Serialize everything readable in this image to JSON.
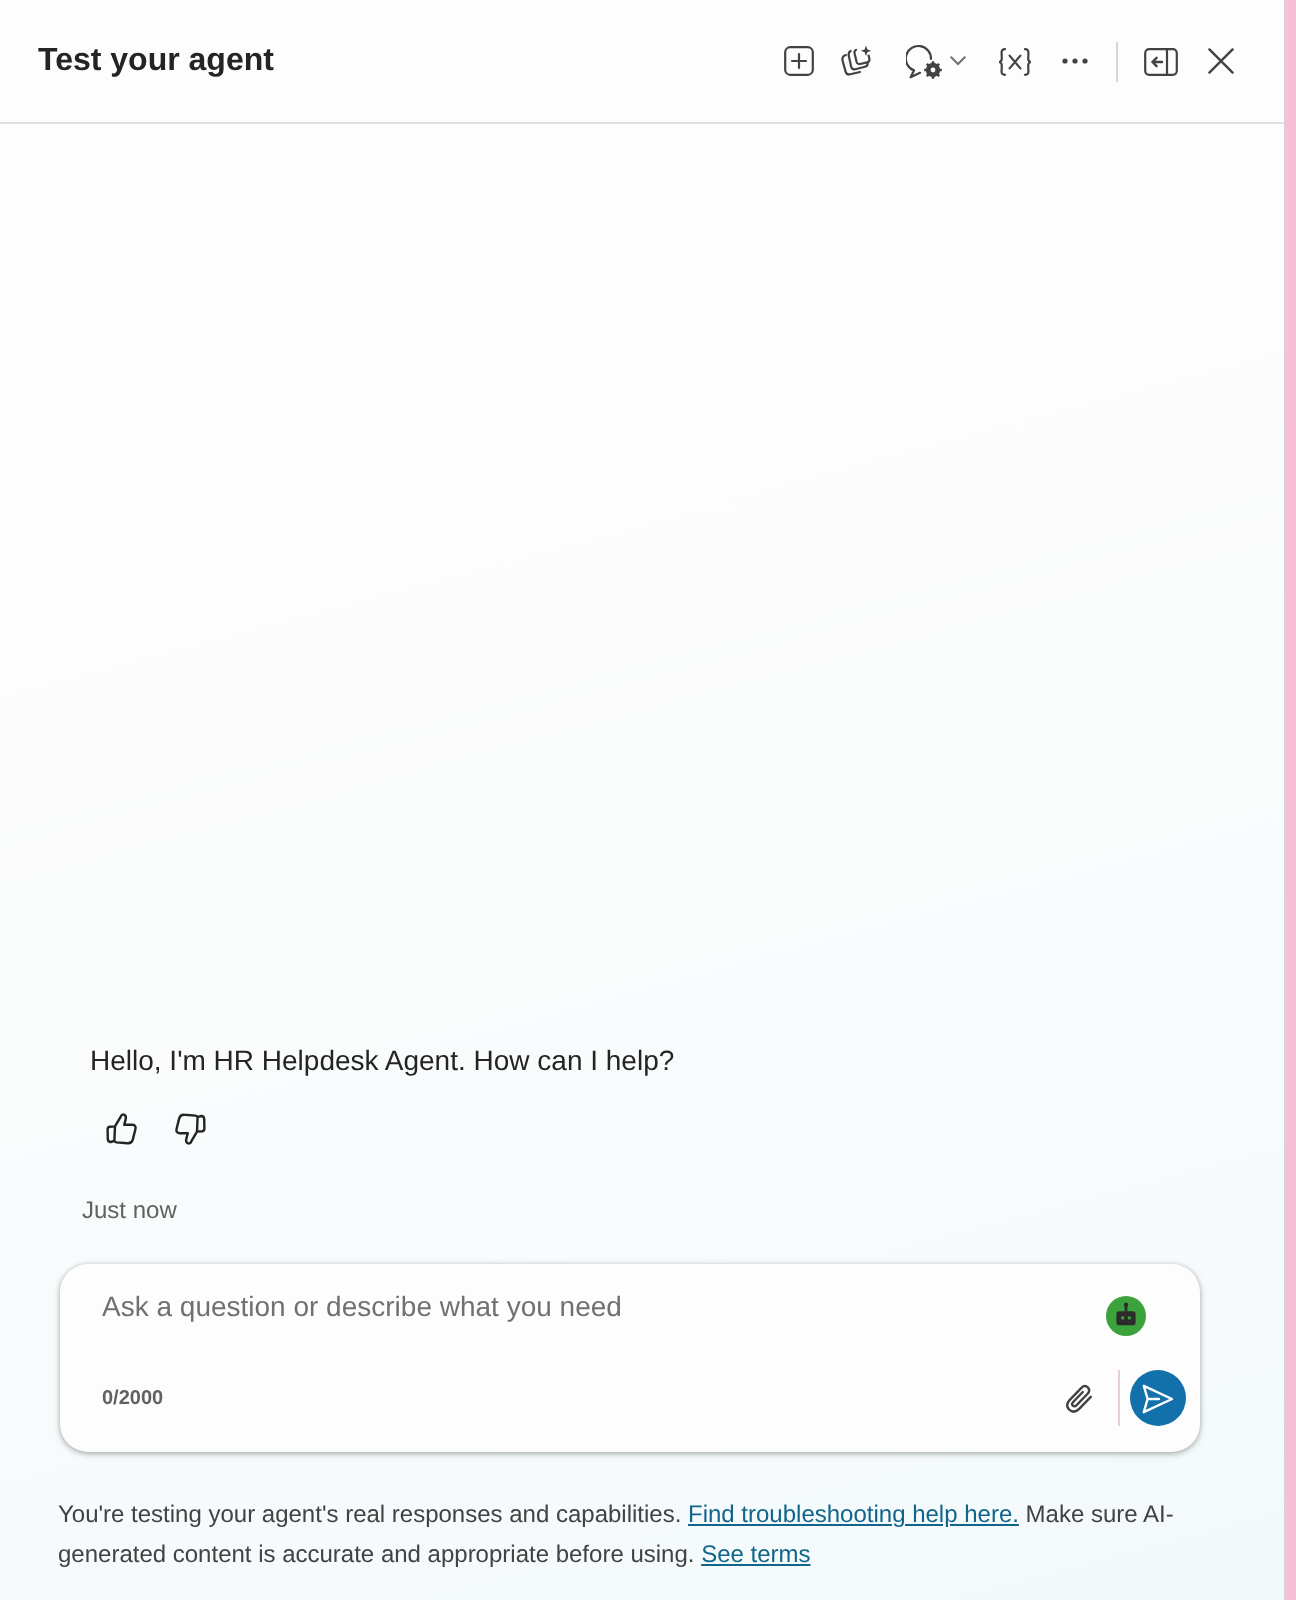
{
  "header": {
    "title": "Test your agent"
  },
  "messages": [
    {
      "kind": "bot",
      "text": "Hello, I'm HR Helpdesk Agent. How can I help?",
      "time": "Just now"
    }
  ],
  "composer": {
    "placeholder": "Ask a question or describe what you need",
    "counter": "0/2000"
  },
  "disclaimer": [
    {
      "kind": "text",
      "text": "You're testing your agent's real responses and capabilities. "
    },
    {
      "kind": "link",
      "text": "Find troubleshooting help here."
    },
    {
      "kind": "text",
      "text": " Make sure AI-generated content is accurate and appropriate before using. "
    },
    {
      "kind": "link",
      "text": "See terms"
    }
  ]
}
